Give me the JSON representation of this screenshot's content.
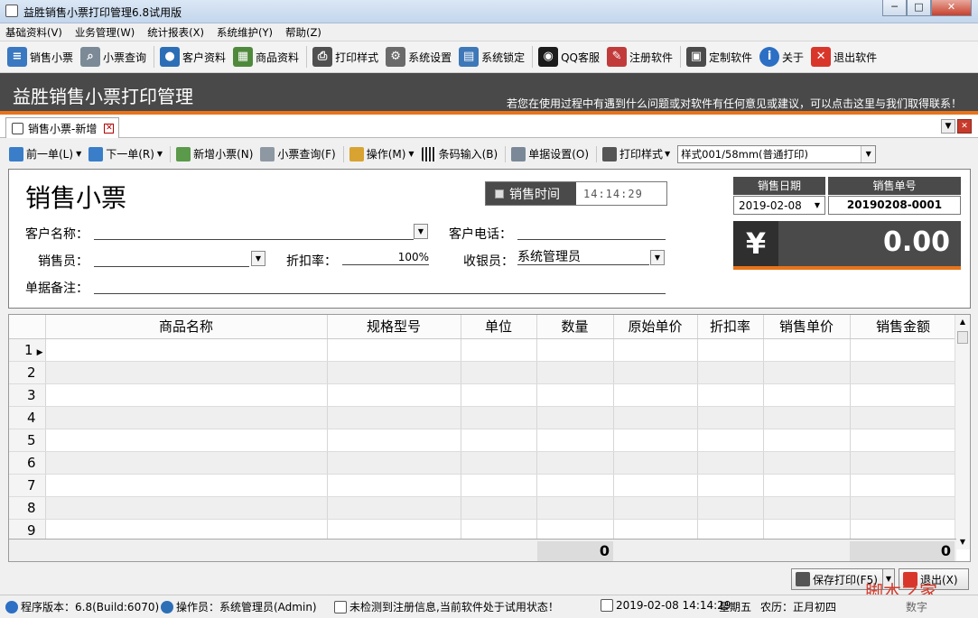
{
  "window": {
    "title": "益胜销售小票打印管理6.8试用版"
  },
  "menu": [
    "基础资料(V)",
    "业务管理(W)",
    "统计报表(X)",
    "系统维护(Y)",
    "帮助(Z)"
  ],
  "toolbar": [
    {
      "label": "销售小票",
      "icon": "receipt-icon",
      "color": "#3a78c2"
    },
    {
      "label": "小票查询",
      "icon": "search-doc-icon",
      "color": "#5a6c7c"
    },
    {
      "label": "客户资料",
      "icon": "users-icon",
      "color": "#2d6fb6"
    },
    {
      "label": "商品资料",
      "icon": "table-icon",
      "color": "#4f8a3c"
    },
    {
      "label": "打印样式",
      "icon": "printer-icon",
      "color": "#505050"
    },
    {
      "label": "系统设置",
      "icon": "gear-icon",
      "color": "#6a6a6a"
    },
    {
      "label": "系统锁定",
      "icon": "lock-icon",
      "color": "#3e78b8"
    },
    {
      "label": "QQ客服",
      "icon": "qq-icon",
      "color": "#1b1b1b"
    },
    {
      "label": "注册软件",
      "icon": "register-icon",
      "color": "#c23b3b"
    },
    {
      "label": "定制软件",
      "icon": "window-icon",
      "color": "#4b4b4b"
    },
    {
      "label": "关于",
      "icon": "info-icon",
      "color": "#2c6fc4"
    },
    {
      "label": "退出软件",
      "icon": "exit-icon",
      "color": "#d9362b"
    }
  ],
  "banner": {
    "title": "益胜销售小票打印管理",
    "notice": "若您在使用过程中有遇到什么问题或对软件有任何意见或建议，可以点击这里与我们取得联系！"
  },
  "tab": {
    "label": "销售小票-新增"
  },
  "subbar": {
    "prev": "前一单(L)",
    "next": "下一单(R)",
    "add": "新增小票(N)",
    "query": "小票查询(F)",
    "ops": "操作(M)",
    "barcode": "条码输入(B)",
    "settings": "单据设置(O)",
    "print_style": "打印样式",
    "style_value": "样式001/58mm(普通打印)"
  },
  "form": {
    "title": "销售小票",
    "sale_time_label": "销售时间",
    "sale_time_value": "14:14:29",
    "date_label": "销售日期",
    "date_value": "2019-02-08",
    "no_label": "销售单号",
    "no_value": "20190208-0001",
    "total_symbol": "¥",
    "total_value": "0.00",
    "customer_label": "客户名称：",
    "customer_value": "",
    "phone_label": "客户电话：",
    "phone_value": "",
    "seller_label": "销售员：",
    "seller_value": "",
    "discount_label": "折扣率：",
    "discount_value": "100%",
    "cashier_label": "收银员：",
    "cashier_value": "系统管理员",
    "note_label": "单据备注：",
    "note_value": ""
  },
  "grid": {
    "columns": [
      "商品名称",
      "规格型号",
      "单位",
      "数量",
      "原始单价",
      "折扣率",
      "销售单价",
      "销售金额"
    ],
    "rows": [
      "1",
      "2",
      "3",
      "4",
      "5",
      "6",
      "7",
      "8",
      "9"
    ],
    "footer_qty": "0",
    "footer_amount": "0"
  },
  "actions": {
    "save_print": "保存打印(F5)",
    "exit": "退出(X)"
  },
  "status": {
    "version": "程序版本：6.8(Build:6070)",
    "operator": "操作员：系统管理员(Admin)",
    "reg": "未检测到注册信息,当前软件处于试用状态！",
    "datetime": "2019-02-08 14:14:29",
    "weekday": "星期五",
    "lunar": "农历：正月初四",
    "numlock": "数字"
  },
  "watermark": "脚本之家"
}
